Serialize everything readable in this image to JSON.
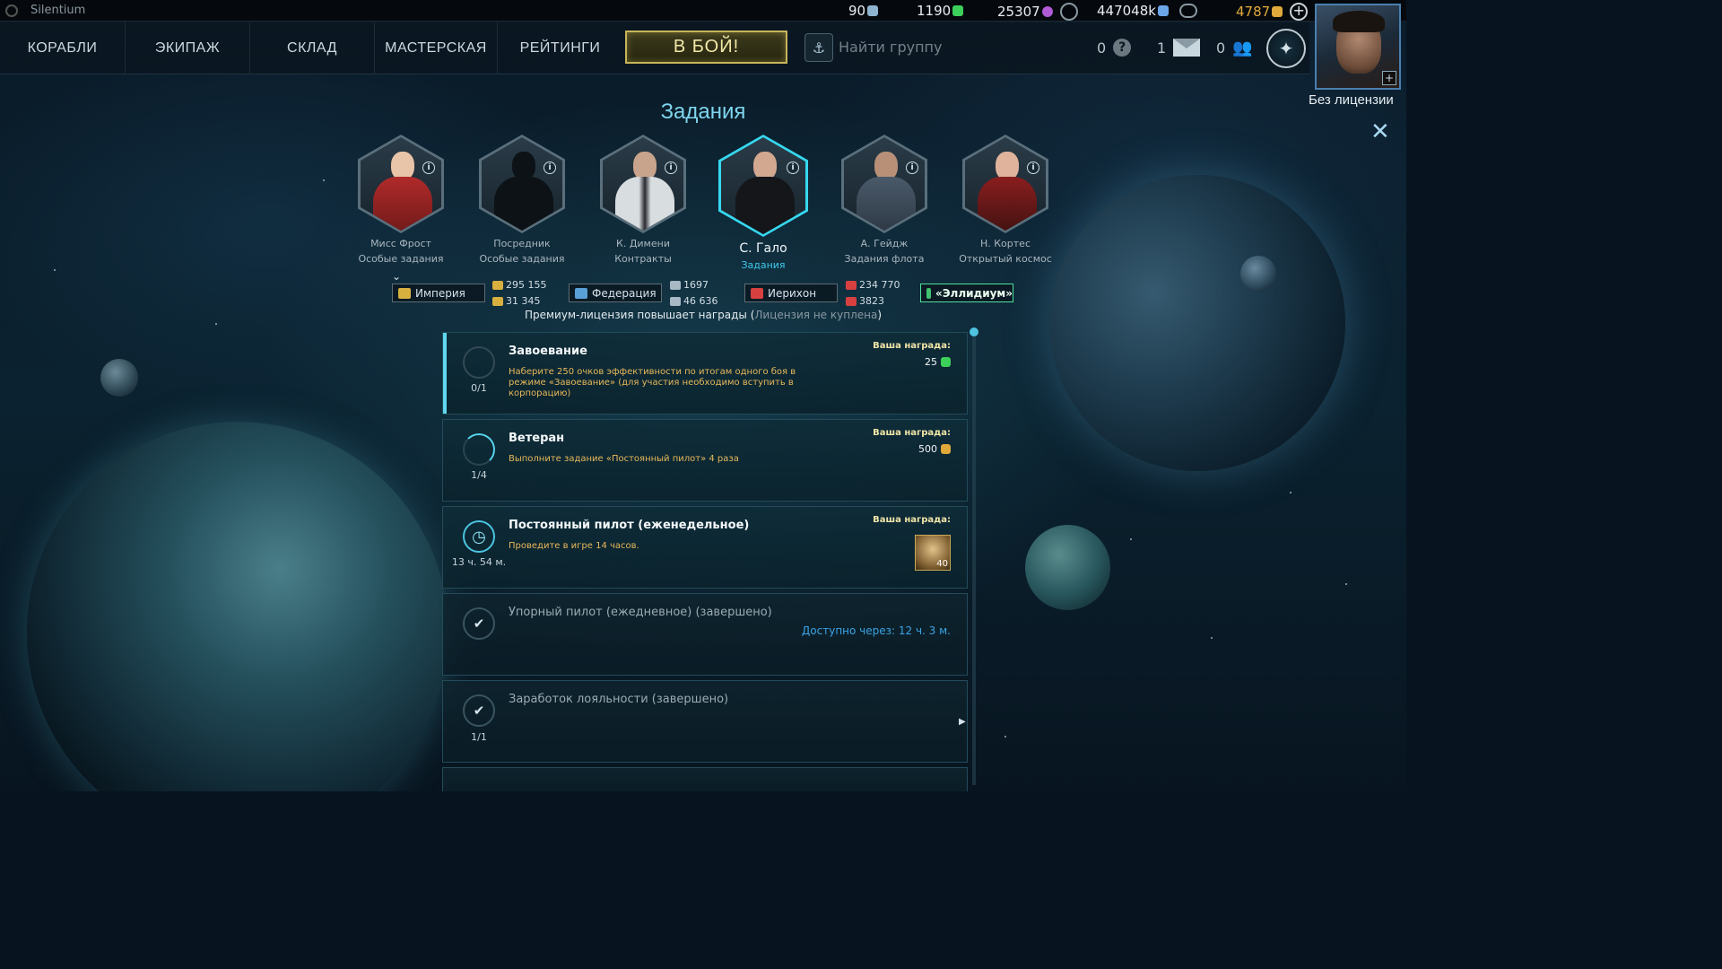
{
  "app": {
    "title": "Silentium"
  },
  "resources": [
    {
      "value": "90",
      "icon": "blue-gear-icon",
      "color": "#8fb4d0"
    },
    {
      "value": "1190",
      "icon": "green-leaf-icon",
      "color": "#3ccf5a"
    },
    {
      "value": "25307",
      "icon": "purple-orb-icon",
      "color": "#b05ad6"
    },
    {
      "value": "447048k",
      "icon": "blue-credit-icon",
      "color": "#6aa6e8"
    },
    {
      "value": "4787",
      "icon": "gold-ore-icon",
      "color": "#e0a93a"
    }
  ],
  "nav": {
    "items": [
      "КОРАБЛИ",
      "ЭКИПАЖ",
      "СКЛАД",
      "МАСТЕРСКАЯ",
      "РЕЙТИНГИ"
    ],
    "battle": "В БОЙ!",
    "find_group": "Найти группу",
    "help_count": "0",
    "mail_count": "1",
    "friends_count": "0"
  },
  "profile": {
    "license": "Без лицензии"
  },
  "page": {
    "title": "Задания"
  },
  "agents": [
    {
      "name": "Мисс Фрост",
      "role": "Особые задания",
      "active": false
    },
    {
      "name": "Посредник",
      "role": "Особые задания",
      "active": false
    },
    {
      "name": "К. Димени",
      "role": "Контракты",
      "active": false
    },
    {
      "name": "С. Гало",
      "role": "Задания",
      "active": true
    },
    {
      "name": "А. Гейдж",
      "role": "Задания флота",
      "active": false
    },
    {
      "name": "Н. Кортес",
      "role": "Открытый космос",
      "active": false
    }
  ],
  "factions": [
    {
      "name": "Империя",
      "color": "#d8b040",
      "stats": [
        "295 155",
        "31 345"
      ]
    },
    {
      "name": "Федерация",
      "color": "#5aa0d8",
      "stats": [
        "1697",
        "46 636"
      ]
    },
    {
      "name": "Иерихон",
      "color": "#d84040",
      "stats": [
        "234 770",
        "3823"
      ]
    },
    {
      "name": "«Эллидиум»",
      "color": "#40c070",
      "stats": []
    }
  ],
  "premium_note": "Премиум-лицензия повышает награды (",
  "premium_status": "Лицензия не куплена",
  "premium_close": ")",
  "reward_label": "Ваша награда:",
  "quests": [
    {
      "title": "Завоевание",
      "desc": "Наберите 250 очков эффективности по итогам одного боя в режиме «Завоевание» (для участия необходимо вступить в корпорацию)",
      "progress": "0/1",
      "reward": "25",
      "reward_icon": "green-leaf-icon"
    },
    {
      "title": "Ветеран",
      "desc": "Выполните задание «Постоянный пилот» 4 раза",
      "progress": "1/4",
      "progress_fraction": 0.25,
      "reward": "500",
      "reward_icon": "gold-ore-icon"
    },
    {
      "title": "Постоянный пилот (еженедельное)",
      "desc": "Проведите в игре 14 часов.",
      "progress": "13 ч. 54 м.",
      "reward": "40",
      "reward_icon": "crystal-crate-icon"
    },
    {
      "title": "Упорный пилот (ежедневное) (завершено)",
      "available": "Доступно через: 12 ч. 3 м."
    },
    {
      "title": "Заработок лояльности (завершено)",
      "progress": "1/1"
    }
  ]
}
